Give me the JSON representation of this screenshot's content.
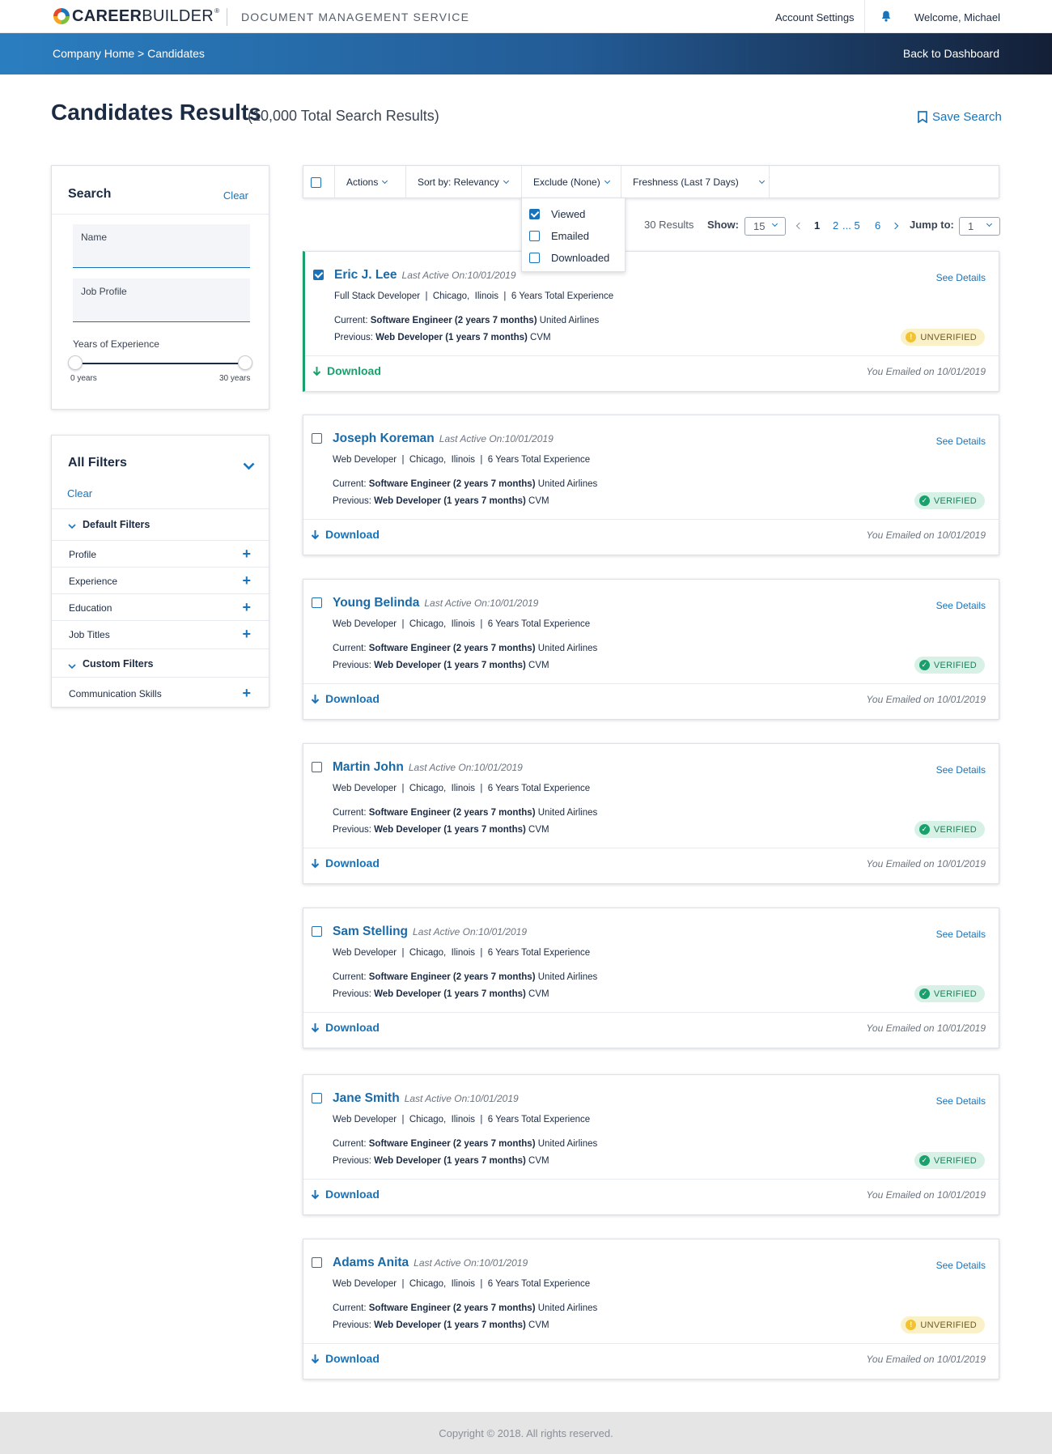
{
  "header": {
    "logo_text_bold": "CAREER",
    "logo_text_light": "BUILDER",
    "logo_reg": "®",
    "service_name": "DOCUMENT MANAGEMENT SERVICE",
    "account_settings": "Account Settings",
    "welcome": "Welcome, Michael"
  },
  "hero": {
    "breadcrumb": "Company Home > Candidates",
    "back_link": "Back to Dashboard"
  },
  "page": {
    "title": "Candidates Results",
    "subtitle": "(10,000 Total Search Results)",
    "save_search": "Save Search"
  },
  "search_panel": {
    "title": "Search",
    "clear": "Clear",
    "name_placeholder": "Name",
    "job_profile_placeholder": "Job Profile",
    "years_label": "Years of Experience",
    "range_min": "0 years",
    "range_max": "30 years",
    "range_min_value": 0,
    "range_max_value": 30
  },
  "filters_panel": {
    "title": "All Filters",
    "clear": "Clear",
    "default_group": "Default Filters",
    "default_items": [
      "Profile",
      "Experience",
      "Education",
      "Job Titles"
    ],
    "custom_group": "Custom Filters",
    "custom_items": [
      "Communication Skills"
    ]
  },
  "toolbar": {
    "actions": "Actions",
    "sort": "Sort by: Relevancy",
    "exclude": "Exclude (None)",
    "freshness": "Freshness (Last 7 Days)"
  },
  "exclude_dropdown": [
    {
      "label": "Viewed",
      "checked": true
    },
    {
      "label": "Emailed",
      "checked": false
    },
    {
      "label": "Downloaded",
      "checked": false
    }
  ],
  "pagination": {
    "results": "30 Results",
    "show_label": "Show:",
    "show_value": "15",
    "pages": [
      "1",
      "2",
      "... 5",
      "6"
    ],
    "jump_label": "Jump to:",
    "jump_value": "1"
  },
  "card_labels": {
    "current_prefix": "Current:",
    "previous_prefix": "Previous:",
    "see_details": "See Details",
    "download": "Download",
    "verified": "VERIFIED",
    "unverified": "UNVERIFIED"
  },
  "candidates": [
    {
      "name": "Eric J. Lee",
      "last_active": "Last Active On:10/01/2019",
      "summary": "Full Stack Developer  |  Chicago,  Ilinois  |  6 Years Total Experience",
      "current_role": "Software Engineer (2 years 7 months)",
      "current_company": "United Airlines",
      "previous_role": "Web Developer (1 years 7 months)",
      "previous_company": "CVM",
      "status": "unverified",
      "emailed": "You Emailed on 10/01/2019",
      "selected": true
    },
    {
      "name": "Joseph Koreman",
      "last_active": "Last Active On:10/01/2019",
      "summary": "Web Developer  |  Chicago,  Ilinois  |  6 Years Total Experience",
      "current_role": "Software Engineer (2 years 7 months)",
      "current_company": "United Airlines",
      "previous_role": "Web Developer (1 years 7 months)",
      "previous_company": "CVM",
      "status": "verified",
      "emailed": "You Emailed on 10/01/2019",
      "selected": false
    },
    {
      "name": "Young Belinda",
      "last_active": "Last Active On:10/01/2019",
      "summary": "Web Developer  |  Chicago,  Ilinois  |  6 Years Total Experience",
      "current_role": "Software Engineer (2 years 7 months)",
      "current_company": "United Airlines",
      "previous_role": "Web Developer (1 years 7 months)",
      "previous_company": "CVM",
      "status": "verified",
      "emailed": "You Emailed on 10/01/2019",
      "selected": false
    },
    {
      "name": "Martin John",
      "last_active": "Last Active On:10/01/2019",
      "summary": "Web Developer  |  Chicago,  Ilinois  |  6 Years Total Experience",
      "current_role": "Software Engineer (2 years 7 months)",
      "current_company": "United Airlines",
      "previous_role": "Web Developer (1 years 7 months)",
      "previous_company": "CVM",
      "status": "verified",
      "emailed": "You Emailed on 10/01/2019",
      "selected": false
    },
    {
      "name": "Sam Stelling",
      "last_active": "Last Active On:10/01/2019",
      "summary": "Web Developer  |  Chicago,  Ilinois  |  6 Years Total Experience",
      "current_role": "Software Engineer (2 years 7 months)",
      "current_company": "United Airlines",
      "previous_role": "Web Developer (1 years 7 months)",
      "previous_company": "CVM",
      "status": "verified",
      "emailed": "You Emailed on 10/01/2019",
      "selected": false
    },
    {
      "name": "Jane Smith",
      "last_active": "Last Active On:10/01/2019",
      "summary": "Web Developer  |  Chicago,  Ilinois  |  6 Years Total Experience",
      "current_role": "Software Engineer (2 years 7 months)",
      "current_company": "United Airlines",
      "previous_role": "Web Developer (1 years 7 months)",
      "previous_company": "CVM",
      "status": "verified",
      "emailed": "You Emailed on 10/01/2019",
      "selected": false
    },
    {
      "name": "Adams Anita",
      "last_active": "Last Active On:10/01/2019",
      "summary": "Web Developer  |  Chicago,  Ilinois  |  6 Years Total Experience",
      "current_role": "Software Engineer (2 years 7 months)",
      "current_company": "United Airlines",
      "previous_role": "Web Developer (1 years 7 months)",
      "previous_company": "CVM",
      "status": "unverified",
      "emailed": "You Emailed on 10/01/2019",
      "selected": false
    }
  ],
  "footer": {
    "copyright": "Copyright © 2018. All rights reserved."
  },
  "colors": {
    "accent": "#1a73b8",
    "verified": "#1aa06d",
    "unverified": "#f2c230",
    "navy": "#1c2b44"
  },
  "icons": {
    "bell": "bell-icon",
    "bookmark": "bookmark-icon",
    "download": "arrow-down-icon",
    "chevron": "chevron-down-icon",
    "plus": "plus-icon",
    "check": "check-icon",
    "info": "exclamation-icon"
  }
}
